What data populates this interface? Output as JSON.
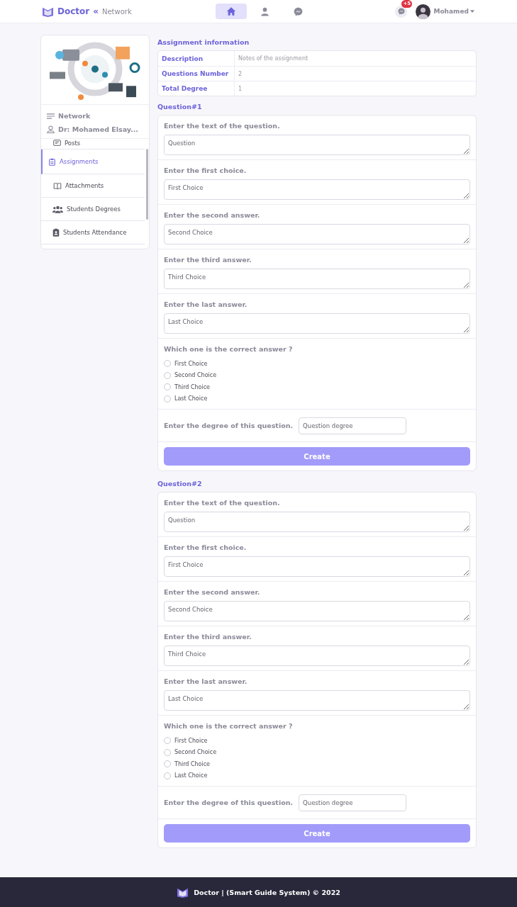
{
  "header": {
    "brand": "Doctor",
    "separator": "«",
    "section": "Network",
    "nav": [
      {
        "kind": "home",
        "selected": true
      },
      {
        "kind": "user",
        "selected": false
      },
      {
        "kind": "messenger",
        "selected": false
      }
    ],
    "messages_badge": "+5",
    "user_name": "Mohamed"
  },
  "sidebar": {
    "network_label": "Network",
    "user_label": "Dr: Mohamed Elsay...",
    "items": [
      {
        "kind": "posts",
        "label": "Posts",
        "selected": false
      },
      {
        "kind": "assignments",
        "label": "Assignments",
        "selected": true
      },
      {
        "kind": "attachments",
        "label": "Attachments",
        "selected": false
      },
      {
        "kind": "degrees",
        "label": "Students Degrees",
        "selected": false
      },
      {
        "kind": "attendance",
        "label": "Students Attendance",
        "selected": false
      }
    ]
  },
  "assignment_info": {
    "title": "Assignment information",
    "rows": [
      {
        "label": "Description",
        "value": "Notes of the assignment"
      },
      {
        "label": "Questions Number",
        "value": "2"
      },
      {
        "label": "Total Degree",
        "value": "1"
      }
    ]
  },
  "questions": [
    {
      "title": "Question#1",
      "fields": [
        {
          "label": "Enter the text of the question.",
          "placeholder": "Question"
        },
        {
          "label": "Enter the first choice.",
          "placeholder": "First Choice"
        },
        {
          "label": "Enter the second answer.",
          "placeholder": "Second Choice"
        },
        {
          "label": "Enter the third answer.",
          "placeholder": "Third Choice"
        },
        {
          "label": "Enter the last answer.",
          "placeholder": "Last Choice"
        }
      ],
      "correct_prompt": "Which one is the correct answer ?",
      "choices": [
        {
          "label": "First Choice",
          "selected": false
        },
        {
          "label": "Second Choice",
          "selected": false
        },
        {
          "label": "Third Choice",
          "selected": false
        },
        {
          "label": "Last Choice",
          "selected": false
        }
      ],
      "degree_label": "Enter the degree of this question.",
      "degree_placeholder": "Question degree",
      "button": "Create"
    },
    {
      "title": "Question#2",
      "fields": [
        {
          "label": "Enter the text of the question.",
          "placeholder": "Question"
        },
        {
          "label": "Enter the first choice.",
          "placeholder": "First Choice"
        },
        {
          "label": "Enter the second answer.",
          "placeholder": "Second Choice"
        },
        {
          "label": "Enter the third answer.",
          "placeholder": "Third Choice"
        },
        {
          "label": "Enter the last answer.",
          "placeholder": "Last Choice"
        }
      ],
      "correct_prompt": "Which one is the correct answer ?",
      "choices": [
        {
          "label": "First Choice",
          "selected": false
        },
        {
          "label": "Second Choice",
          "selected": false
        },
        {
          "label": "Third Choice",
          "selected": false
        },
        {
          "label": "Last Choice",
          "selected": false
        }
      ],
      "degree_label": "Enter the degree of this question.",
      "degree_placeholder": "Question degree",
      "button": "Create"
    }
  ],
  "footer": {
    "text": "Doctor | (Smart Guide System) © 2022"
  }
}
